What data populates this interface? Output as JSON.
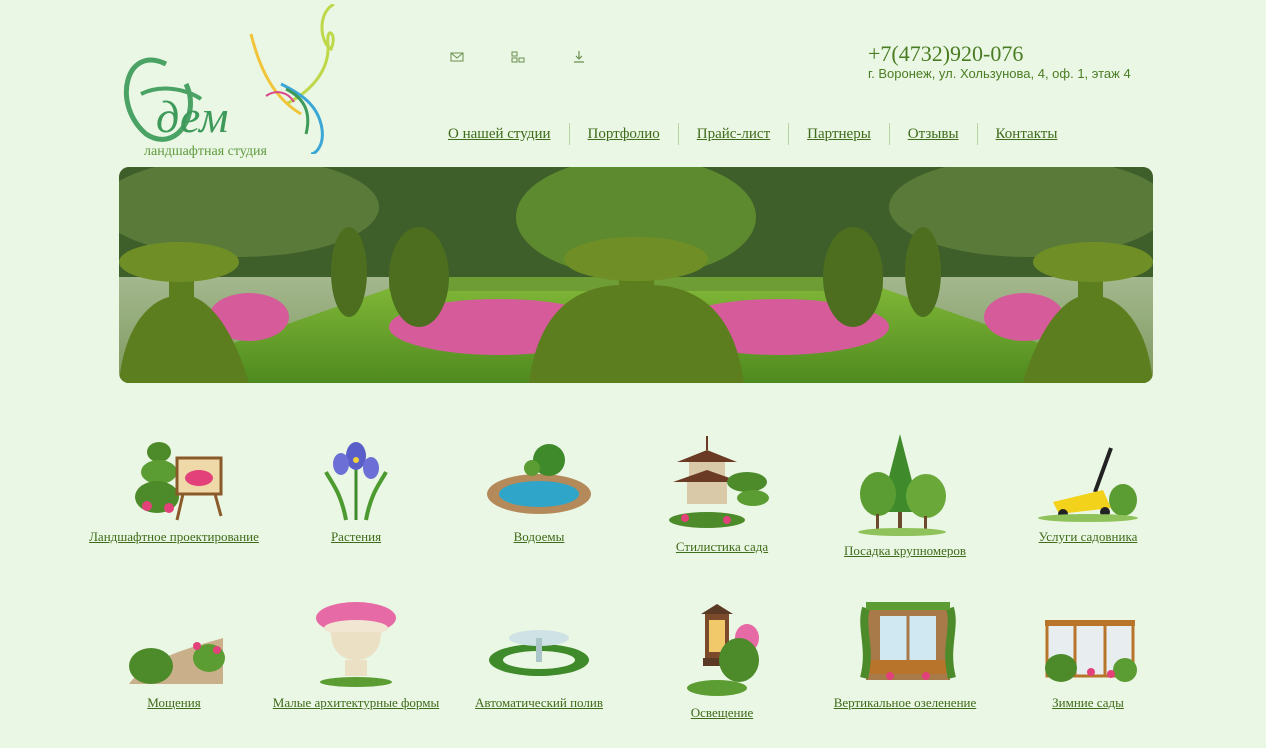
{
  "header": {
    "logo_title": "Эдем",
    "logo_subtitle": "ландшафтная студия",
    "phone": "+7(4732)920-076",
    "address": "г. Воронеж, ул. Хользунова, 4, оф. 1, этаж 4",
    "icons": [
      "mail-icon",
      "sitemap-icon",
      "download-icon"
    ]
  },
  "nav": {
    "items": [
      "О нашей студии",
      "Портфолио",
      "Прайс-лист",
      "Партнеры",
      "Отзывы",
      "Контакты"
    ]
  },
  "services": [
    {
      "label": "Ландшафтное проектирование",
      "icon": "easel-topiary-icon"
    },
    {
      "label": "Растения",
      "icon": "iris-flower-icon"
    },
    {
      "label": "Водоемы",
      "icon": "pond-icon"
    },
    {
      "label": "Стилистика сада",
      "icon": "pagoda-icon"
    },
    {
      "label": "Посадка крупномеров",
      "icon": "trees-icon"
    },
    {
      "label": "Услуги садовника",
      "icon": "lawnmower-icon"
    },
    {
      "label": "Мощения",
      "icon": "paving-path-icon"
    },
    {
      "label": "Малые архитектурные формы",
      "icon": "flower-vase-icon"
    },
    {
      "label": "Автоматический полив",
      "icon": "fountain-icon"
    },
    {
      "label": "Освещение",
      "icon": "garden-lantern-icon"
    },
    {
      "label": "Вертикальное озеленение",
      "icon": "window-vines-icon"
    },
    {
      "label": "Зимние сады",
      "icon": "winter-garden-icon"
    }
  ]
}
